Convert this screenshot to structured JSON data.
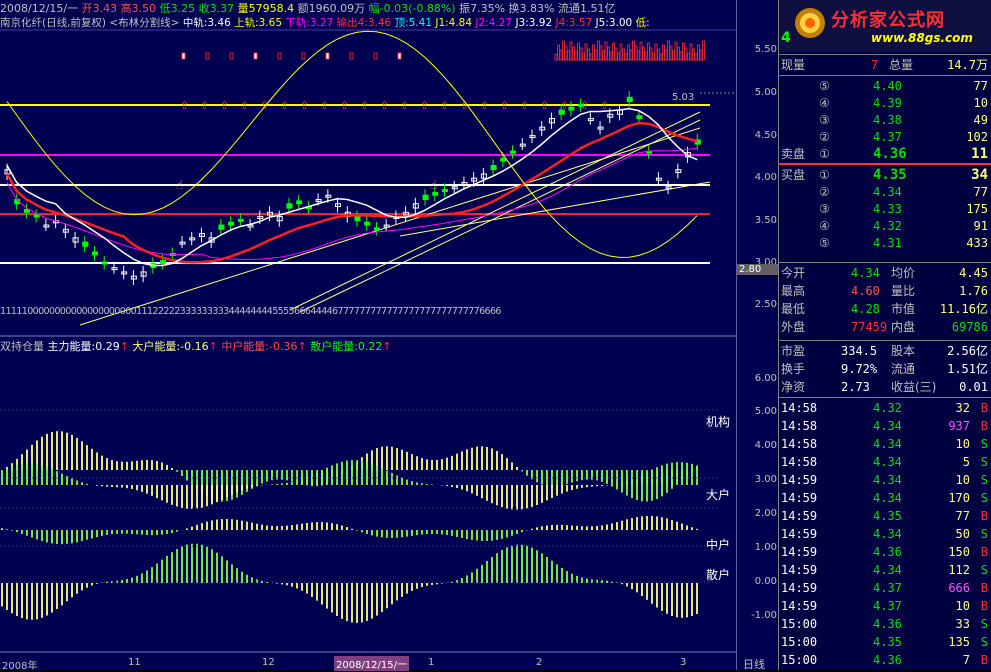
{
  "header": {
    "line1": "南京化纤(日线,前复权)",
    "date": "2008/12/15/一",
    "open": "开3.43",
    "high": "高3.50",
    "low": "低3.25",
    "close": "收3.37",
    "volume": "量57958.4",
    "amount": "额1960.09万",
    "change": "幅-0.03(-0.88%)",
    "amplitude": "振7.35%",
    "turnover": "换3.83%",
    "float": "流通1.51亿",
    "indicator_name": "<布林分割线>",
    "mid": "中轨:3.46",
    "upper": "上轨:3.65",
    "lower": "下轨:3.27",
    "output": "输出4:3.46",
    "top": "顶:5.41",
    "j1": "J1:4.84",
    "j2": "J2:4.27",
    "j3": "J3:3.92",
    "j4": "J4:3.57",
    "j5": "J5:3.00",
    "low_label": "低:"
  },
  "logo": {
    "title": "分析家公式网",
    "url": "www.88gs.com"
  },
  "chart_annotations": {
    "peak_label": "5.03",
    "trough_label": "2.80",
    "code_row": "11111000000000000000000001112222233333333344444444555566644446777777777777777777777777776666"
  },
  "lower_header": {
    "name": "双持仓量",
    "main": "主力能量:0.29",
    "big": "大户能量:-0.16",
    "mid": "中户能量:-0.36",
    "retail": "散户能量:0.22"
  },
  "lower_labels": [
    "机构",
    "大户",
    "中户",
    "散户"
  ],
  "price_axis": [
    "5.50",
    "5.00",
    "4.50",
    "4.00",
    "3.50",
    "3.00",
    "2.50"
  ],
  "lower_axis": [
    "6.00",
    "5.00",
    "4.00",
    "3.00",
    "2.00",
    "1.00",
    "0.00",
    "-1.00"
  ],
  "date_axis": [
    "2008年",
    "11",
    "12",
    "2008/12/15/一",
    "1",
    "2",
    "3",
    "日线"
  ],
  "quote": {
    "code_prefix": "4",
    "now_label": "现量",
    "now_value": "7",
    "total_label": "总量",
    "total_value": "14.7万",
    "sells": [
      {
        "label": "⑤",
        "price": "4.40",
        "vol": "77"
      },
      {
        "label": "④",
        "price": "4.39",
        "vol": "10"
      },
      {
        "label": "③",
        "price": "4.38",
        "vol": "49"
      },
      {
        "label": "②",
        "price": "4.37",
        "vol": "102"
      },
      {
        "label": "①",
        "price": "4.36",
        "vol": "11"
      }
    ],
    "sell_title": "卖盘",
    "buy_title": "买盘",
    "buys": [
      {
        "label": "①",
        "price": "4.35",
        "vol": "34"
      },
      {
        "label": "②",
        "price": "4.34",
        "vol": "77"
      },
      {
        "label": "③",
        "price": "4.33",
        "vol": "175"
      },
      {
        "label": "④",
        "price": "4.32",
        "vol": "91"
      },
      {
        "label": "⑤",
        "price": "4.31",
        "vol": "433"
      }
    ],
    "stats1": [
      {
        "l1": "今开",
        "v1": "4.34",
        "l2": "均价",
        "v2": "4.45"
      },
      {
        "l1": "最高",
        "v1": "4.60",
        "l2": "量比",
        "v2": "1.76"
      },
      {
        "l1": "最低",
        "v1": "4.28",
        "l2": "市值",
        "v2": "11.16亿"
      },
      {
        "l1": "外盘",
        "v1": "77459",
        "l2": "内盘",
        "v2": "69786"
      }
    ],
    "stats2": [
      {
        "l1": "市盈",
        "v1": "334.5",
        "l2": "股本",
        "v2": "2.56亿"
      },
      {
        "l1": "换手",
        "v1": "9.72%",
        "l2": "流通",
        "v2": "1.51亿"
      },
      {
        "l1": "净资",
        "v1": "2.73",
        "l2": "收益(三)",
        "v2": "0.01"
      }
    ],
    "ticks": [
      {
        "t": "14:58",
        "p": "4.32",
        "v": "32",
        "s": "B"
      },
      {
        "t": "14:58",
        "p": "4.34",
        "v": "937",
        "s": "B"
      },
      {
        "t": "14:58",
        "p": "4.34",
        "v": "10",
        "s": "S"
      },
      {
        "t": "14:58",
        "p": "4.34",
        "v": "5",
        "s": "S"
      },
      {
        "t": "14:59",
        "p": "4.34",
        "v": "10",
        "s": "S"
      },
      {
        "t": "14:59",
        "p": "4.34",
        "v": "170",
        "s": "S"
      },
      {
        "t": "14:59",
        "p": "4.35",
        "v": "77",
        "s": "B"
      },
      {
        "t": "14:59",
        "p": "4.34",
        "v": "50",
        "s": "S"
      },
      {
        "t": "14:59",
        "p": "4.36",
        "v": "150",
        "s": "B"
      },
      {
        "t": "14:59",
        "p": "4.34",
        "v": "112",
        "s": "S"
      },
      {
        "t": "14:59",
        "p": "4.37",
        "v": "666",
        "s": "B"
      },
      {
        "t": "14:59",
        "p": "4.37",
        "v": "10",
        "s": "B"
      },
      {
        "t": "15:00",
        "p": "4.36",
        "v": "33",
        "s": "S"
      },
      {
        "t": "15:00",
        "p": "4.35",
        "v": "135",
        "s": "S"
      },
      {
        "t": "15:00",
        "p": "4.36",
        "v": "7",
        "s": "B"
      }
    ]
  },
  "colors": {
    "bg": "#000050",
    "up": "#ff3030",
    "down": "#00c000",
    "gold": "#ffff00",
    "magenta": "#ff00ff"
  }
}
